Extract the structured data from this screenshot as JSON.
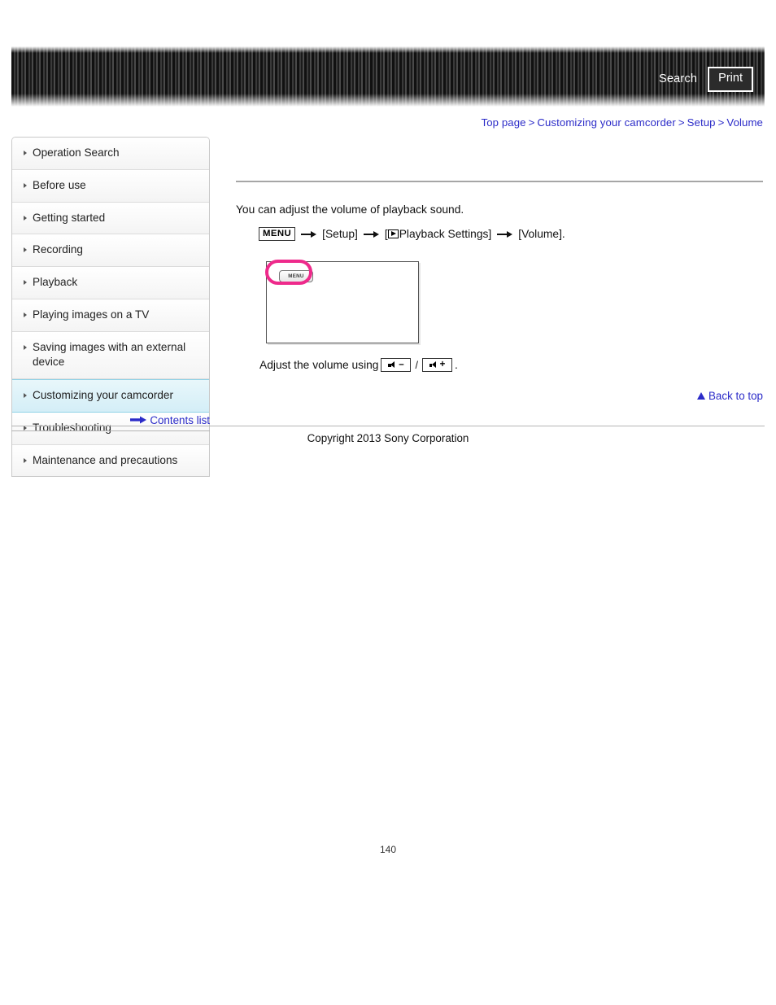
{
  "header": {
    "search_label": "Search",
    "print_label": "Print",
    "search_icon": "search-icon",
    "print_icon": "print-icon"
  },
  "breadcrumb": {
    "separator": ">",
    "items": [
      {
        "label": "Top page"
      },
      {
        "label": "Customizing your camcorder"
      },
      {
        "label": "Setup"
      },
      {
        "label": "Volume"
      }
    ]
  },
  "sidebar": {
    "items": [
      {
        "label": "Operation Search",
        "active": false
      },
      {
        "label": "Before use",
        "active": false
      },
      {
        "label": "Getting started",
        "active": false
      },
      {
        "label": "Recording",
        "active": false
      },
      {
        "label": "Playback",
        "active": false
      },
      {
        "label": "Playing images on a TV",
        "active": false
      },
      {
        "label": "Saving images with an external device",
        "active": false
      },
      {
        "label": "Customizing your camcorder",
        "active": true
      },
      {
        "label": "Troubleshooting",
        "active": false
      },
      {
        "label": "Maintenance and precautions",
        "active": false
      }
    ],
    "contents_list_label": "Contents list",
    "contents_list_icon": "right-arrow-icon"
  },
  "main": {
    "intro": "You can adjust the volume of playback sound.",
    "menu_path": {
      "menu_badge": "MENU",
      "playback_icon": "playback-triangle-icon",
      "steps": [
        "[Setup]",
        "[",
        "Playback Settings]",
        "[Volume]."
      ],
      "step_setup": "[Setup]",
      "step_playback_open": "[",
      "step_playback": "Playback Settings]",
      "step_volume": "[Volume]."
    },
    "illustration": {
      "menu_button_label": "MENU",
      "highlight_color": "#ee2a8b",
      "alt": "Camcorder LCD screen with MENU button highlighted"
    },
    "volume_instruction": {
      "prefix": "Adjust the volume using",
      "minus_icon": "volume-down-icon",
      "minus_sign": "–",
      "separator": "/",
      "plus_icon": "volume-up-icon",
      "plus_sign": "+",
      "suffix": "."
    },
    "back_to_top": {
      "label": "Back to top",
      "icon": "up-triangle-icon"
    }
  },
  "footer": {
    "copyright": "Copyright 2013 Sony Corporation",
    "page_number": "140"
  },
  "colors": {
    "link": "#2b2bc8",
    "active_nav": "#d4eef7",
    "highlight": "#ee2a8b",
    "header_dark": "#111111"
  }
}
